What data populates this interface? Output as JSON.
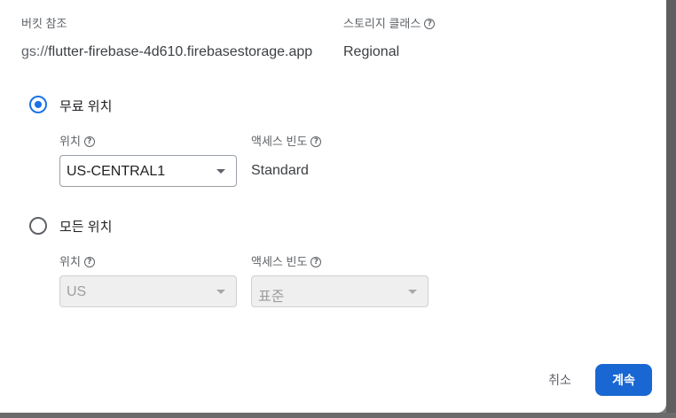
{
  "bucket": {
    "ref_label": "버킷 참조",
    "ref_scheme": "gs://",
    "ref_value": "flutter-firebase-4d610.firebasestorage.app",
    "storage_class_label": "스토리지 클래스",
    "storage_class_value": "Regional"
  },
  "options": {
    "free_location": {
      "label": "무료 위치",
      "selected": true,
      "location_label": "위치",
      "location_value": "US-CENTRAL1",
      "access_label": "액세스 빈도",
      "access_value": "Standard"
    },
    "all_locations": {
      "label": "모든 위치",
      "selected": false,
      "location_label": "위치",
      "location_value": "US",
      "access_label": "액세스 빈도",
      "access_value": "표준"
    }
  },
  "actions": {
    "cancel_label": "취소",
    "continue_label": "계속"
  },
  "colors": {
    "accent": "#1a73e8",
    "primary_button": "#1967d2"
  },
  "icons": {
    "help": "help-circle-icon",
    "dropdown": "arrow-drop-down-icon"
  }
}
